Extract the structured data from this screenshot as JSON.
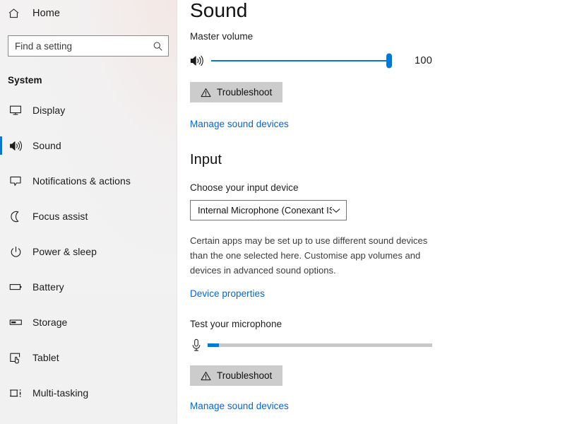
{
  "sidebar": {
    "home": {
      "label": "Home",
      "icon": "home-icon"
    },
    "search": {
      "placeholder": "Find a setting",
      "value": "",
      "icon": "search-icon"
    },
    "category": "System",
    "items": [
      {
        "label": "Display",
        "icon": "monitor-icon",
        "selected": false
      },
      {
        "label": "Sound",
        "icon": "speaker-icon",
        "selected": true
      },
      {
        "label": "Notifications & actions",
        "icon": "notification-icon",
        "selected": false
      },
      {
        "label": "Focus assist",
        "icon": "moon-icon",
        "selected": false
      },
      {
        "label": "Power & sleep",
        "icon": "power-icon",
        "selected": false
      },
      {
        "label": "Battery",
        "icon": "battery-icon",
        "selected": false
      },
      {
        "label": "Storage",
        "icon": "storage-icon",
        "selected": false
      },
      {
        "label": "Tablet",
        "icon": "tablet-icon",
        "selected": false
      },
      {
        "label": "Multi-tasking",
        "icon": "multitasking-icon",
        "selected": false
      }
    ]
  },
  "content": {
    "page_title": "Sound",
    "output": {
      "master_volume_label": "Master volume",
      "master_volume_value": "100",
      "master_volume_percent": 100,
      "speaker_icon": "speaker-icon",
      "troubleshoot_label": "Troubleshoot",
      "troubleshoot_icon": "warning-triangle-icon",
      "manage_devices_link": "Manage sound devices"
    },
    "input": {
      "heading": "Input",
      "choose_device_label": "Choose your input device",
      "device_value": "Internal Microphone (Conexant ISST...",
      "chevron_icon": "chevron-down-icon",
      "description": "Certain apps may be set up to use different sound devices than the one selected here. Customise app volumes and devices in advanced sound options.",
      "device_properties_link": "Device properties",
      "test_mic_label": "Test your microphone",
      "mic_icon": "microphone-icon",
      "mic_level_percent": 5,
      "troubleshoot_label": "Troubleshoot",
      "troubleshoot_icon": "warning-triangle-icon",
      "manage_devices_link": "Manage sound devices"
    }
  },
  "colors": {
    "accent": "#0078d7",
    "link": "#0a64c8",
    "sidebar_bg": "#f1f1f1",
    "button_bg": "#cccccc",
    "track": "#868686"
  }
}
